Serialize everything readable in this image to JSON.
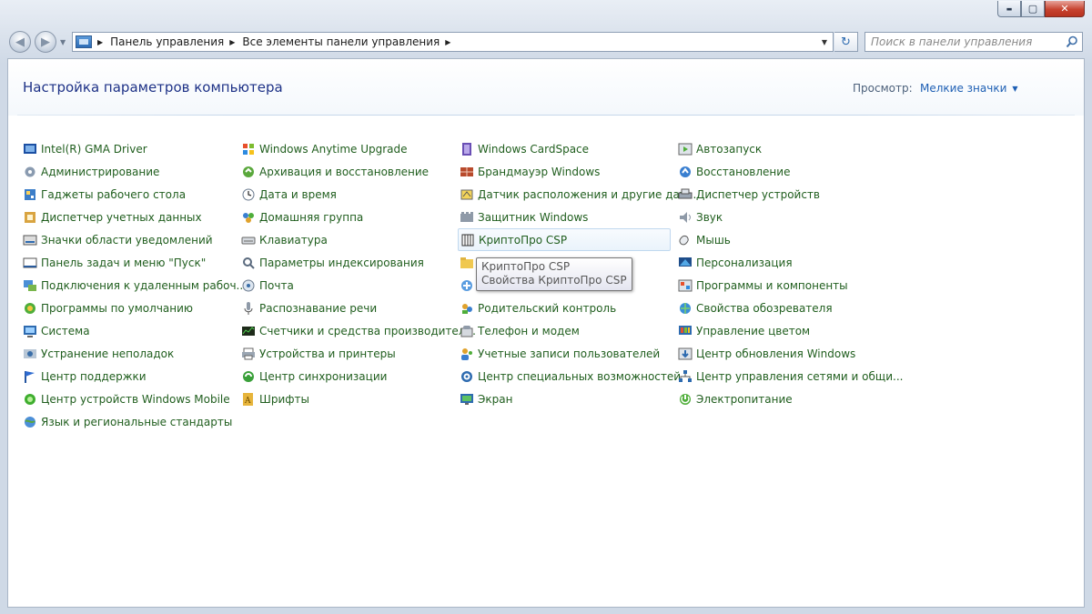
{
  "window": {
    "caption_buttons": {
      "minimize": "▬",
      "maximize": "▢",
      "close": "✕"
    }
  },
  "nav": {
    "back_icon": "back-arrow-icon",
    "forward_icon": "forward-arrow-icon",
    "breadcrumb": [
      "Панель управления",
      "Все элементы панели управления"
    ],
    "search_placeholder": "Поиск в панели управления"
  },
  "header": {
    "title": "Настройка параметров компьютера",
    "view_label": "Просмотр:",
    "view_value": "Мелкие значки"
  },
  "columns": [
    [
      {
        "label": "Intel(R) GMA Driver",
        "icon": "intel-gma-icon"
      },
      {
        "label": "Администрирование",
        "icon": "admin-tools-icon"
      },
      {
        "label": "Гаджеты рабочего стола",
        "icon": "gadgets-icon"
      },
      {
        "label": "Диспетчер учетных данных",
        "icon": "credential-manager-icon"
      },
      {
        "label": "Значки области уведомлений",
        "icon": "notification-icons-icon"
      },
      {
        "label": "Панель задач и меню \"Пуск\"",
        "icon": "taskbar-icon"
      },
      {
        "label": "Подключения к удаленным рабоч...",
        "icon": "remote-desktop-icon"
      },
      {
        "label": "Программы по умолчанию",
        "icon": "default-programs-icon"
      },
      {
        "label": "Система",
        "icon": "system-icon"
      },
      {
        "label": "Устранение неполадок",
        "icon": "troubleshooting-icon"
      },
      {
        "label": "Центр поддержки",
        "icon": "action-center-icon"
      },
      {
        "label": "Центр устройств Windows Mobile",
        "icon": "windows-mobile-icon"
      },
      {
        "label": "Язык и региональные стандарты",
        "icon": "region-language-icon"
      }
    ],
    [
      {
        "label": "Windows Anytime Upgrade",
        "icon": "anytime-upgrade-icon"
      },
      {
        "label": "Архивация и восстановление",
        "icon": "backup-restore-icon"
      },
      {
        "label": "Дата и время",
        "icon": "date-time-icon"
      },
      {
        "label": "Домашняя группа",
        "icon": "homegroup-icon"
      },
      {
        "label": "Клавиатура",
        "icon": "keyboard-icon"
      },
      {
        "label": "Параметры индексирования",
        "icon": "indexing-options-icon"
      },
      {
        "label": "Почта",
        "icon": "mail-icon"
      },
      {
        "label": "Распознавание речи",
        "icon": "speech-recognition-icon"
      },
      {
        "label": "Счетчики и средства производител...",
        "icon": "performance-icon"
      },
      {
        "label": "Устройства и принтеры",
        "icon": "devices-printers-icon"
      },
      {
        "label": "Центр синхронизации",
        "icon": "sync-center-icon"
      },
      {
        "label": "Шрифты",
        "icon": "fonts-icon"
      }
    ],
    [
      {
        "label": "Windows CardSpace",
        "icon": "cardspace-icon"
      },
      {
        "label": "Брандмауэр Windows",
        "icon": "firewall-icon"
      },
      {
        "label": "Датчик расположения и другие дат...",
        "icon": "location-sensor-icon"
      },
      {
        "label": "Защитник Windows",
        "icon": "defender-icon"
      },
      {
        "label": "КриптоПро CSP",
        "icon": "cryptopro-icon"
      },
      {
        "label": "",
        "icon": "folder-options-icon"
      },
      {
        "label": "",
        "icon": "getting-started-icon"
      },
      {
        "label": "Родительский контроль",
        "icon": "parental-controls-icon"
      },
      {
        "label": "Телефон и модем",
        "icon": "phone-modem-icon"
      },
      {
        "label": "Учетные записи пользователей",
        "icon": "user-accounts-icon"
      },
      {
        "label": "Центр специальных возможностей",
        "icon": "ease-of-access-icon"
      },
      {
        "label": "Экран",
        "icon": "display-icon"
      }
    ],
    [
      {
        "label": "Автозапуск",
        "icon": "autoplay-icon"
      },
      {
        "label": "Восстановление",
        "icon": "recovery-icon"
      },
      {
        "label": "Диспетчер устройств",
        "icon": "device-manager-icon"
      },
      {
        "label": "Звук",
        "icon": "sound-icon"
      },
      {
        "label": "Мышь",
        "icon": "mouse-icon"
      },
      {
        "label": "Персонализация",
        "icon": "personalization-icon"
      },
      {
        "label": "Программы и компоненты",
        "icon": "programs-features-icon"
      },
      {
        "label": "Свойства обозревателя",
        "icon": "internet-options-icon"
      },
      {
        "label": "Управление цветом",
        "icon": "color-management-icon"
      },
      {
        "label": "Центр обновления Windows",
        "icon": "windows-update-icon"
      },
      {
        "label": "Центр управления сетями и общи...",
        "icon": "network-center-icon"
      },
      {
        "label": "Электропитание",
        "icon": "power-options-icon"
      }
    ]
  ],
  "tooltip": {
    "title": "КриптоПро CSP",
    "description": "Свойства КриптоПро CSP"
  },
  "colors": {
    "link": "#205e1e",
    "title": "#1e3287",
    "view_link": "#1e5fb4"
  }
}
